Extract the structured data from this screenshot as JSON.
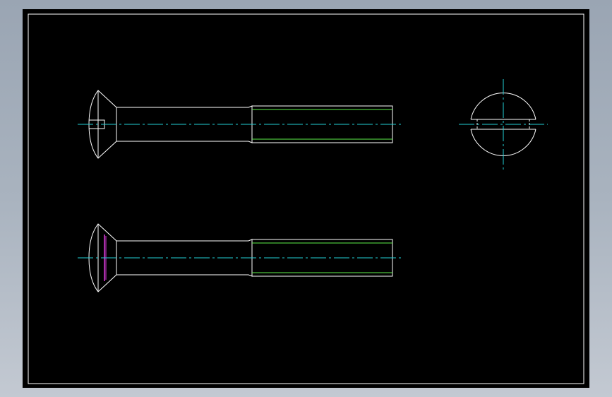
{
  "colors": {
    "background_gradient_top": "#9aa5b3",
    "background_gradient_bottom": "#c3c9d2",
    "canvas": "#000000",
    "outline": "#ffffff",
    "centerline": "#22cfd6",
    "thread": "#5ef04a",
    "hidden_edge": "#e03ce0"
  },
  "drawing": {
    "views": [
      "screw-side-view",
      "screw-front-view",
      "screw-top-view"
    ]
  }
}
